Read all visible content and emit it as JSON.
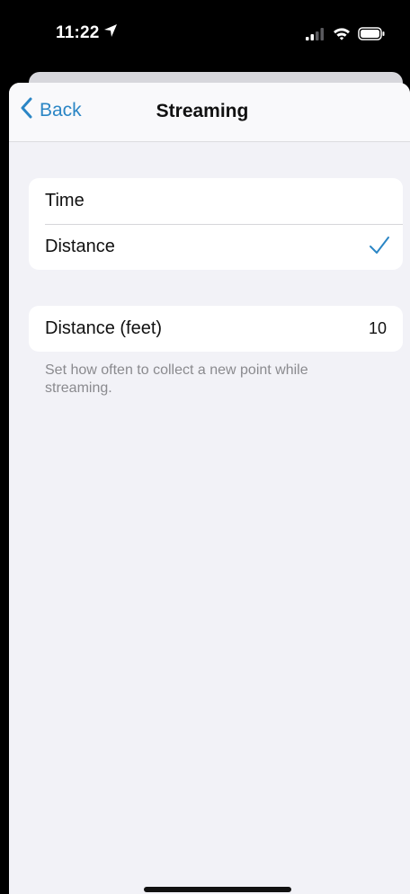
{
  "status_bar": {
    "time": "11:22",
    "icons": [
      "location-arrow-icon",
      "signal-icon",
      "wifi-icon",
      "battery-icon"
    ]
  },
  "nav": {
    "back_label": "Back",
    "title": "Streaming"
  },
  "mode_options": [
    {
      "label": "Time",
      "selected": false
    },
    {
      "label": "Distance",
      "selected": true
    }
  ],
  "distance_setting": {
    "label": "Distance (feet)",
    "value": "10"
  },
  "footer_note": "Set how often to collect a new point while streaming.",
  "colors": {
    "accent": "#2b86c5",
    "background": "#f2f2f7",
    "cell": "#ffffff",
    "secondary_text": "#8a8a8e"
  }
}
